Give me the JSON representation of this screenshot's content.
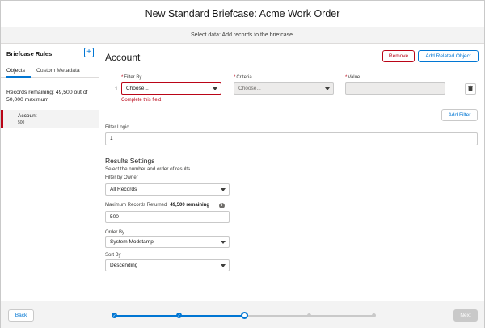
{
  "header": {
    "title": "New Standard Briefcase: Acme Work Order"
  },
  "subheader": {
    "text": "Select data: Add records to the briefcase."
  },
  "sidebar": {
    "title": "Briefcase Rules",
    "add_label": "+",
    "tabs": [
      {
        "label": "Objects",
        "active": true
      },
      {
        "label": "Custom Metadata",
        "active": false
      }
    ],
    "records_remaining": "Records remaining: 49,500 out of 50,000 maximum",
    "objects": [
      {
        "name": "Account",
        "count": "500",
        "selected": true
      }
    ]
  },
  "main": {
    "title": "Account",
    "remove_label": "Remove",
    "add_related_label": "Add Related Object",
    "filter": {
      "row_number": "1",
      "filter_by_label": "Filter By",
      "filter_by_placeholder": "Choose...",
      "criteria_label": "Criteria",
      "criteria_placeholder": "Choose...",
      "value_label": "Value",
      "error_text": "Complete this field.",
      "add_filter_label": "Add Filter"
    },
    "filter_logic": {
      "label": "Filter Logic",
      "value": "1"
    },
    "results": {
      "title": "Results Settings",
      "subtitle": "Select the number and order of results.",
      "filter_by_owner_label": "Filter by Owner",
      "filter_by_owner_value": "All Records",
      "max_records_label": "Maximum Records Returned",
      "max_records_remaining": "49,500 remaining",
      "max_records_value": "500",
      "order_by_label": "Order By",
      "order_by_value": "System Modstamp",
      "sort_by_label": "Sort By",
      "sort_by_value": "Descending"
    }
  },
  "footer": {
    "back_label": "Back",
    "next_label": "Next",
    "progress": {
      "total_steps": 5,
      "current_step": 3
    }
  },
  "icons": {
    "delete": "trash-icon",
    "info": "info-icon",
    "check": "check-icon",
    "dropdown": "chevron-down-icon"
  },
  "colors": {
    "brand": "#0176d3",
    "error": "#ba0517",
    "disabled": "#c9c9c9"
  }
}
